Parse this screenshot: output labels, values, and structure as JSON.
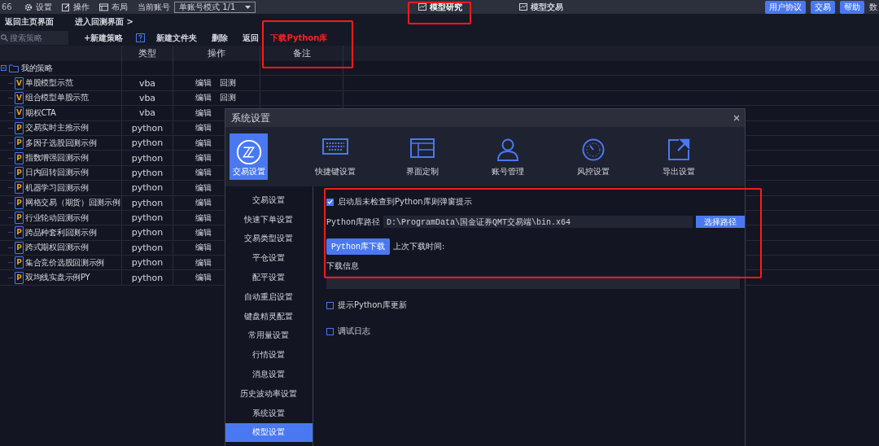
{
  "topbar": {
    "cut_label": "66",
    "menu": [
      {
        "label": "设置",
        "kind": "gear"
      },
      {
        "label": "操作",
        "kind": "edit"
      },
      {
        "label": "布局",
        "kind": "layout"
      }
    ],
    "account_label": "当前账号",
    "account_mode": "单账号模式 1/1",
    "tabs": [
      {
        "label": "模型研究",
        "selected": true
      },
      {
        "label": "模型交易",
        "selected": false
      }
    ],
    "buttons": [
      "用户协议",
      "交易",
      "帮助"
    ],
    "cut_right": "数"
  },
  "breadcrumb": [
    "返回主页界面",
    "进入回测界面 >"
  ],
  "toolbar": {
    "search": {
      "placeholder": "搜索策略"
    },
    "new_strategy": "+新建策略",
    "new_folder": "新建文件夹",
    "delete": "删除",
    "back": "返回",
    "note": "下载Python库"
  },
  "table": {
    "columns": [
      "类型",
      "操作",
      "备注"
    ],
    "folder": "我的策略",
    "rows": [
      {
        "name": "单股模型示范",
        "type": "vba",
        "badge": "V",
        "actions": [
          "编辑",
          "回测"
        ]
      },
      {
        "name": "组合模型单股示范",
        "type": "vba",
        "badge": "V",
        "actions": [
          "编辑",
          "回测"
        ]
      },
      {
        "name": "期权CTA",
        "type": "vba",
        "badge": "V",
        "actions": [
          "编辑"
        ]
      },
      {
        "name": "交易实时主推示例",
        "type": "python",
        "badge": "P",
        "actions": [
          "编辑"
        ]
      },
      {
        "name": "多因子选股回测示例",
        "type": "python",
        "badge": "P",
        "actions": [
          "编辑"
        ]
      },
      {
        "name": "指数增强回测示例",
        "type": "python",
        "badge": "P",
        "actions": [
          "编辑"
        ]
      },
      {
        "name": "日内回转回测示例",
        "type": "python",
        "badge": "P",
        "actions": [
          "编辑"
        ]
      },
      {
        "name": "机器学习回测示例",
        "type": "python",
        "badge": "P",
        "actions": [
          "编辑"
        ]
      },
      {
        "name": "网格交易（期货）回测示例",
        "type": "python",
        "badge": "P",
        "actions": [
          "编辑"
        ]
      },
      {
        "name": "行业轮动回测示例",
        "type": "python",
        "badge": "P",
        "actions": [
          "编辑"
        ]
      },
      {
        "name": "跨品种套利回测示例",
        "type": "python",
        "badge": "P",
        "actions": [
          "编辑"
        ]
      },
      {
        "name": "跨式期权回测示例",
        "type": "python",
        "badge": "P",
        "actions": [
          "编辑"
        ]
      },
      {
        "name": "集合竞价选股回测示例",
        "type": "python",
        "badge": "P",
        "actions": [
          "编辑"
        ]
      },
      {
        "name": "双均线实盘示例PY",
        "type": "python",
        "badge": "P",
        "actions": [
          "编辑"
        ]
      }
    ]
  },
  "dialog": {
    "title": "系统设置",
    "tabs": [
      {
        "label": "交易设置",
        "kind": "trade",
        "selected": true
      },
      {
        "label": "快捷键设置",
        "kind": "keyboard",
        "selected": false
      },
      {
        "label": "界面定制",
        "kind": "layout",
        "selected": false
      },
      {
        "label": "账号管理",
        "kind": "account",
        "selected": false
      },
      {
        "label": "风控设置",
        "kind": "risk",
        "selected": false
      },
      {
        "label": "导出设置",
        "kind": "export",
        "selected": false
      }
    ],
    "menu": [
      {
        "label": "交易设置",
        "selected": false
      },
      {
        "label": "快速下单设置",
        "selected": false
      },
      {
        "label": "交易类型设置",
        "selected": false
      },
      {
        "label": "平仓设置",
        "selected": false
      },
      {
        "label": "配平设置",
        "selected": false
      },
      {
        "label": "自动重启设置",
        "selected": false
      },
      {
        "label": "键盘精灵配置",
        "selected": false
      },
      {
        "label": "常用量设置",
        "selected": false
      },
      {
        "label": "行情设置",
        "selected": false
      },
      {
        "label": "消息设置",
        "selected": false
      },
      {
        "label": "历史波动率设置",
        "selected": false
      },
      {
        "label": "系统设置",
        "selected": false
      },
      {
        "label": "模型设置",
        "selected": true
      }
    ],
    "popup_check": {
      "label": "启动后未检查到Python库则弹窗提示",
      "checked": true
    },
    "path_label": "Python库路径",
    "path_value": "D:\\ProgramData\\国金证券QMT交易端\\bin.x64",
    "choose_button": "选择路径",
    "download_button": "Python库下载",
    "last_download": "上次下载时间:",
    "info_label": "下载信息",
    "options": [
      {
        "label": "提示Python库更新",
        "checked": false
      },
      {
        "label": "调试日志",
        "checked": false
      }
    ]
  }
}
